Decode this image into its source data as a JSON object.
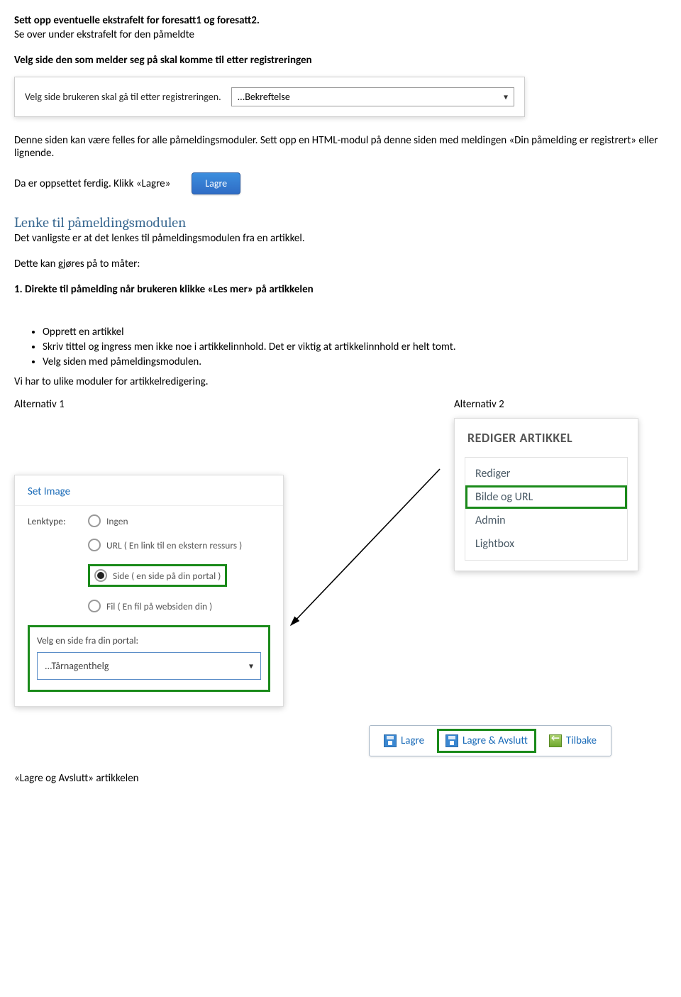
{
  "headings": {
    "h1": "Sett opp eventuelle ekstrafelt for foresatt1 og foresatt2.",
    "h1_sub": "Se over under ekstrafelt for den påmeldte",
    "h2": "Velg side den som melder seg på skal komme til etter registreringen",
    "h_link": "Lenke til påmeldingsmodulen"
  },
  "reg": {
    "label": "Velg side brukeren skal gå til etter registreringen.",
    "dropdown_value": "...Bekreftelse"
  },
  "para1": "Denne siden kan være felles for alle påmeldingsmoduler. Sett opp en HTML-modul på denne siden med meldingen «Din påmelding er registrert» eller lignende.",
  "para_lagre": "Da er oppsettet ferdig. Klikk «Lagre»",
  "btn_lagre": "Lagre",
  "link_intro": "Det vanligste er at det lenkes til påmeldingsmodulen fra en artikkel.",
  "link_ways": "Dette kan gjøres på to måter:",
  "way1_title": "1. Direkte til påmelding når brukeren klikke «Les mer» på artikkelen",
  "bullets": {
    "b1": "Opprett en artikkel",
    "b2": "Skriv tittel og ingress men ikke noe i artikkelinnhold. Det er viktig at artikkelinnhold er helt tomt.",
    "b3": "Velg siden med påmeldingsmodulen."
  },
  "two_modules": "Vi har to ulike moduler for artikkelredigering.",
  "alt1_label": "Alternativ 1",
  "alt2_label": "Alternativ 2",
  "set_image": {
    "title": "Set Image",
    "lenktype_label": "Lenktype:",
    "r1": "Ingen",
    "r2": "URL ( En link til en ekstern ressurs )",
    "r3": "Side ( en side på din portal )",
    "r4": "Fil ( En fil på websiden din )",
    "portal_label": "Velg en side fra din portal:",
    "portal_value": "...Tårnagenthelg"
  },
  "panel2": {
    "title": "REDIGER ARTIKKEL",
    "items": [
      "Rediger",
      "Bilde og URL",
      "Admin",
      "Lightbox"
    ]
  },
  "toolbar": {
    "lagre": "Lagre",
    "lagre_avslutt": "Lagre & Avslutt",
    "tilbake": "Tilbake"
  },
  "final": "«Lagre og Avslutt» artikkelen"
}
